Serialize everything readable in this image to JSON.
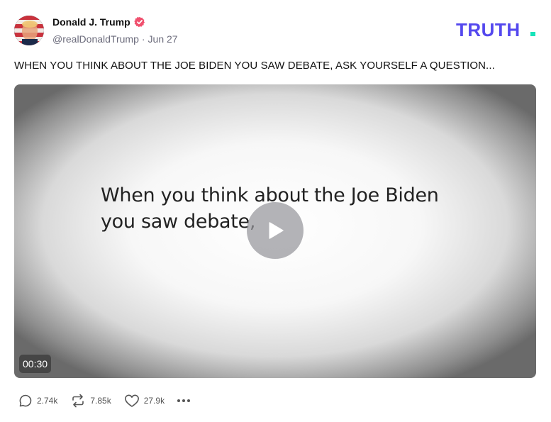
{
  "author": {
    "name": "Donald J. Trump",
    "handle": "@realDonaldTrump",
    "separator": "·",
    "date": "Jun 27",
    "verified_icon": "verified-badge-icon",
    "verified_color": "#f0506e"
  },
  "brand": {
    "logo_text": "TRUTH",
    "logo_dot": ".",
    "primary_color": "#5448ee",
    "dot_color": "#17e3b9"
  },
  "post": {
    "text": "WHEN YOU THINK ABOUT THE JOE BIDEN YOU SAW DEBATE, ASK YOURSELF A QUESTION..."
  },
  "video": {
    "caption_line1": "When you think about the Joe Biden",
    "caption_line2": "you saw debate,",
    "duration": "00:30",
    "play_icon": "play-icon"
  },
  "actions": {
    "replies": "2.74k",
    "reposts": "7.85k",
    "likes": "27.9k",
    "reply_icon": "comment-icon",
    "repost_icon": "repost-icon",
    "like_icon": "heart-icon",
    "more_icon": "more-icon"
  }
}
